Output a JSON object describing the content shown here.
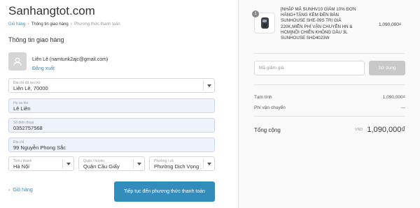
{
  "store": {
    "name": "Sanhangtot.com"
  },
  "breadcrumb": [
    {
      "label": "Giỏ hàng",
      "state": "link"
    },
    {
      "label": "Thông tin giao hàng",
      "state": "current"
    },
    {
      "label": "Phương thức thanh toán",
      "state": "muted"
    }
  ],
  "shipping": {
    "title": "Thông tin giao hàng",
    "user_email": "Liên Lê (namtunk2ajc@gmail.com)",
    "logout": "Đăng xuất",
    "saved_address": {
      "label": "Địa chỉ đã lưu trữ",
      "value": "Liên Lê, 70000"
    },
    "name": {
      "label": "Họ và tên",
      "value": "Lê Liên"
    },
    "phone": {
      "label": "Số điện thoại",
      "value": "0352757568"
    },
    "address": {
      "label": "Địa chỉ",
      "value": "99 Nguyễn Phong Sắc"
    },
    "city": {
      "label": "Tỉnh / thành",
      "value": "Hà Nội"
    },
    "district": {
      "label": "Quận / huyện",
      "value": "Quận Cầu Giấy"
    },
    "ward": {
      "label": "Phường / xã",
      "value": "Phường Dịch Vọng"
    }
  },
  "actions": {
    "back": "Giỏ hàng",
    "continue": "Tiếp tục đến phương thức thanh toán"
  },
  "order": {
    "product": {
      "quantity": "1",
      "name": "[NHẬP MÃ SUNHV10 GIẢM 10% ĐƠN HÀNG+Tặng kèm Đèn bàn Sunhouse SHE-09S trị giá 220k,miễn phí vận chuyển HN & HCM]NỒI CHIÊN KHÔNG DẦU 3L SUNHOUSE SHD4023W",
      "price": "1,090,000₫"
    },
    "discount": {
      "placeholder": "Mã giảm giá",
      "button": "Sử dụng"
    },
    "subtotal": {
      "label": "Tạm tính",
      "value": "1,090,000₫"
    },
    "shipping_fee": {
      "label": "Phí vận chuyển",
      "value": "—"
    },
    "total": {
      "label": "Tổng cộng",
      "currency": "VND",
      "value": "1,090,000₫"
    }
  },
  "colors": {
    "accent": "#338dbc",
    "filled_field": "#eef3fb",
    "disabled_button": "#c8c8c8"
  }
}
